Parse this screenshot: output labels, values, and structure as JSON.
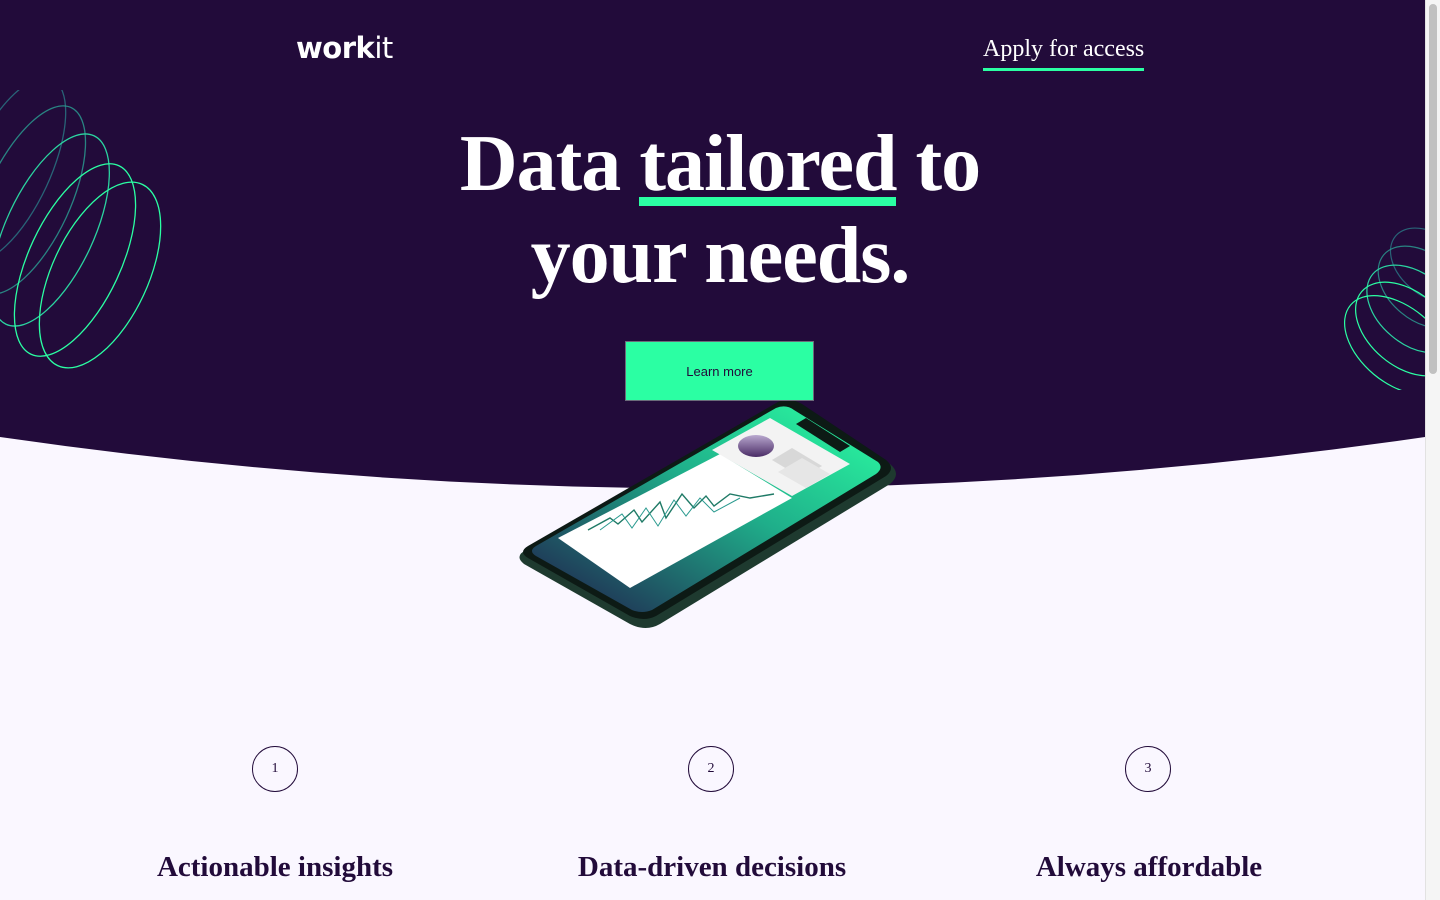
{
  "colors": {
    "navy": "#220b3a",
    "accent": "#2bffa3",
    "light_bg": "#faf7ff",
    "white": "#ffffff"
  },
  "header": {
    "logo_bold": "work",
    "logo_light": "it",
    "apply_label": "Apply for access"
  },
  "hero": {
    "headline_pre": "Data ",
    "headline_highlight": "tailored",
    "headline_post": " to",
    "headline_line2": "your needs.",
    "cta_label": "Learn more"
  },
  "features": [
    {
      "number": "1",
      "title": "Actionable insights"
    },
    {
      "number": "2",
      "title": "Data-driven decisions"
    },
    {
      "number": "3",
      "title": "Always affordable"
    }
  ],
  "icons": {
    "left_decoration": "spiral-icon",
    "right_decoration": "spiral-icon",
    "phone": "phone-illustration-icon"
  }
}
